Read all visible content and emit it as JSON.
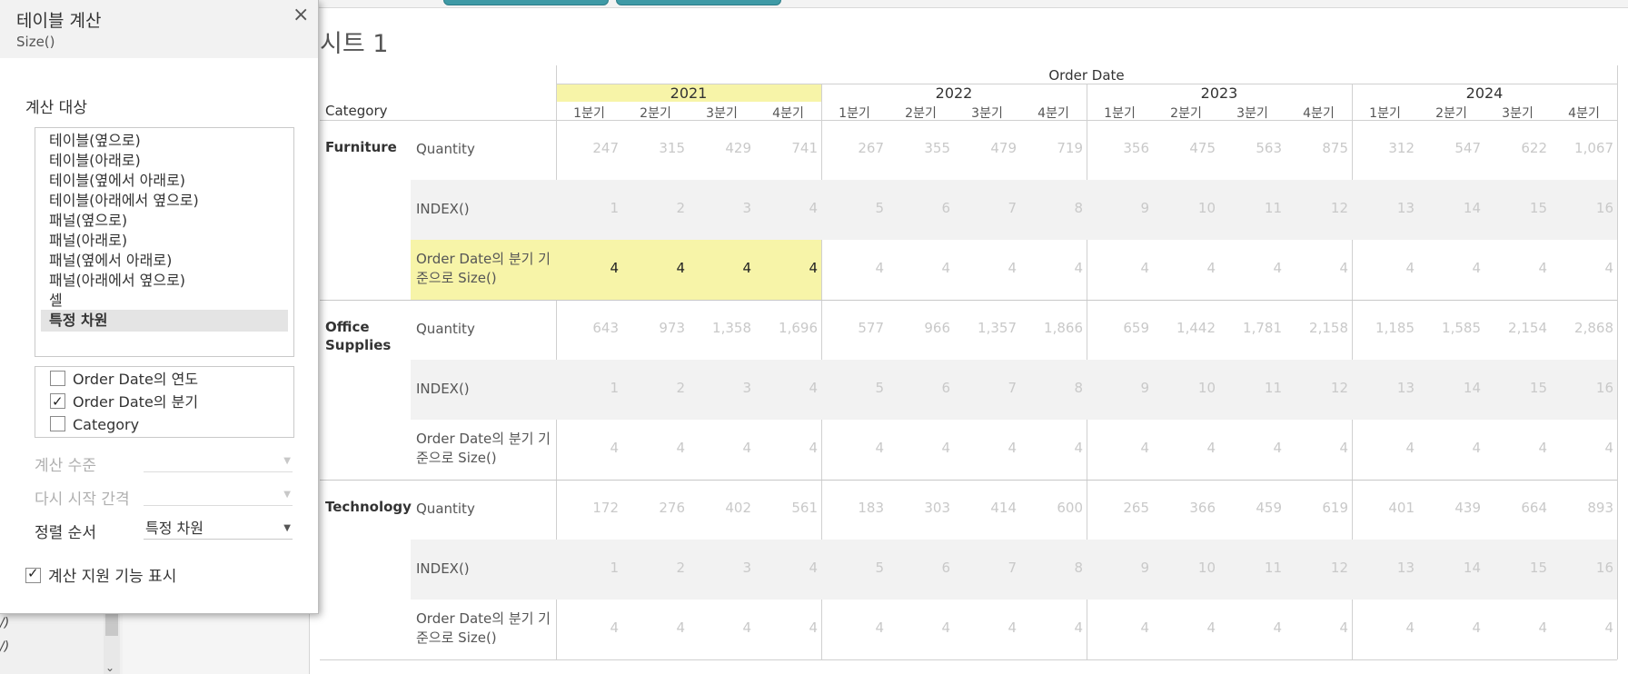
{
  "dialog": {
    "title": "테이블 계산",
    "subtitle": "Size()",
    "close_icon": "close-icon",
    "compute_using_label": "계산 대상",
    "compute_using_options": [
      "테이블(옆으로)",
      "테이블(아래로)",
      "테이블(옆에서 아래로)",
      "테이블(아래에서 옆으로)",
      "패널(옆으로)",
      "패널(아래로)",
      "패널(옆에서 아래로)",
      "패널(아래에서 옆으로)",
      "셀",
      "특정 차원"
    ],
    "selected_option": "특정 차원",
    "dimensions": [
      {
        "label": "Order Date의 연도",
        "checked": false
      },
      {
        "label": "Order Date의 분기",
        "checked": true
      },
      {
        "label": "Category",
        "checked": false
      }
    ],
    "at_level_label": "계산 수준",
    "at_level_value": "",
    "restart_every_label": "다시 시작 간격",
    "restart_every_value": "",
    "sort_order_label": "정렬 순서",
    "sort_order_value": "특정 차원",
    "show_assistance_label": "계산 지원 기능 표시",
    "show_assistance_checked": true
  },
  "background": {
    "left_fragments": [
      "/)",
      "/)"
    ]
  },
  "sheet": {
    "title": "시트 1",
    "column_header": "Order Date",
    "row_header": "Category",
    "years": [
      "2021",
      "2022",
      "2023",
      "2024"
    ],
    "highlighted_year": "2021",
    "quarters": [
      "1분기",
      "2분기",
      "3분기",
      "4분기"
    ],
    "categories": [
      {
        "name": "Furniture",
        "rows": [
          {
            "measure": "Quantity",
            "values": [
              "247",
              "315",
              "429",
              "741",
              "267",
              "355",
              "479",
              "719",
              "356",
              "475",
              "563",
              "875",
              "312",
              "547",
              "622",
              "1,067"
            ]
          },
          {
            "measure": "INDEX()",
            "values": [
              "1",
              "2",
              "3",
              "4",
              "5",
              "6",
              "7",
              "8",
              "9",
              "10",
              "11",
              "12",
              "13",
              "14",
              "15",
              "16"
            ]
          },
          {
            "measure": "Order Date의 분기 기준으로 Size()",
            "highlight": true,
            "values": [
              "4",
              "4",
              "4",
              "4",
              "4",
              "4",
              "4",
              "4",
              "4",
              "4",
              "4",
              "4",
              "4",
              "4",
              "4",
              "4"
            ]
          }
        ]
      },
      {
        "name": "Office Supplies",
        "rows": [
          {
            "measure": "Quantity",
            "values": [
              "643",
              "973",
              "1,358",
              "1,696",
              "577",
              "966",
              "1,357",
              "1,866",
              "659",
              "1,442",
              "1,781",
              "2,158",
              "1,185",
              "1,585",
              "2,154",
              "2,868"
            ]
          },
          {
            "measure": "INDEX()",
            "values": [
              "1",
              "2",
              "3",
              "4",
              "5",
              "6",
              "7",
              "8",
              "9",
              "10",
              "11",
              "12",
              "13",
              "14",
              "15",
              "16"
            ]
          },
          {
            "measure": "Order Date의 분기 기준으로 Size()",
            "values": [
              "4",
              "4",
              "4",
              "4",
              "4",
              "4",
              "4",
              "4",
              "4",
              "4",
              "4",
              "4",
              "4",
              "4",
              "4",
              "4"
            ]
          }
        ]
      },
      {
        "name": "Technology",
        "rows": [
          {
            "measure": "Quantity",
            "values": [
              "172",
              "276",
              "402",
              "561",
              "183",
              "303",
              "414",
              "600",
              "265",
              "366",
              "459",
              "619",
              "401",
              "439",
              "664",
              "893"
            ]
          },
          {
            "measure": "INDEX()",
            "values": [
              "1",
              "2",
              "3",
              "4",
              "5",
              "6",
              "7",
              "8",
              "9",
              "10",
              "11",
              "12",
              "13",
              "14",
              "15",
              "16"
            ]
          },
          {
            "measure": "Order Date의 분기 기준으로 Size()",
            "values": [
              "4",
              "4",
              "4",
              "4",
              "4",
              "4",
              "4",
              "4",
              "4",
              "4",
              "4",
              "4",
              "4",
              "4",
              "4",
              "4"
            ]
          }
        ]
      }
    ],
    "colors": {
      "highlight": "#f7f4a8",
      "band": "#f2f2f2",
      "accent_teal": "#3f9aa6"
    }
  }
}
